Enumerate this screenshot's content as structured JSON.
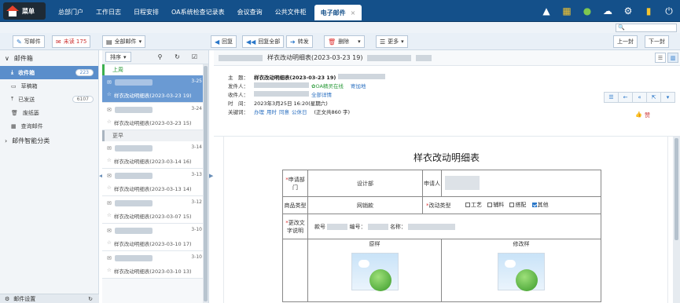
{
  "topbar": {
    "menu_label": "菜单",
    "tabs": [
      {
        "label": "总部门户"
      },
      {
        "label": "工作日志"
      },
      {
        "label": "日程安排"
      },
      {
        "label": "OA系统检查记录表"
      },
      {
        "label": "会议查询"
      },
      {
        "label": "公共文件柜"
      }
    ],
    "active_tab": {
      "label": "电子邮件",
      "close": "×"
    },
    "icons": [
      "notification-icon",
      "apps-icon",
      "user-icon",
      "cloud-icon",
      "gear-icon",
      "clipboard-icon",
      "power-icon"
    ]
  },
  "search": {
    "placeholder": "",
    "icon": "🔍"
  },
  "toolbar": {
    "write": "写邮件",
    "unread": "未读 175",
    "all_mail": "全部邮件",
    "reply": "回复",
    "reply_all": "回复全部",
    "forward": "转发",
    "delete": "删除",
    "more": "更多",
    "prev": "上一封",
    "next": "下一封"
  },
  "sidebar": {
    "mailbox_title": "邮件箱",
    "items": [
      {
        "label": "收件箱",
        "count": "223"
      },
      {
        "label": "草稿箱",
        "count": ""
      },
      {
        "label": "已发送",
        "count": "6107"
      },
      {
        "label": "废纸篓",
        "count": ""
      },
      {
        "label": "查询邮件",
        "count": ""
      }
    ],
    "smart_title": "邮件智能分类",
    "footer": "邮件设置"
  },
  "maillist": {
    "sort_label": "排序",
    "group_recent": "上周",
    "group_earlier": "更早",
    "mails": [
      {
        "date": "3-25",
        "subject": "样衣改动明细表(2023-03-23 19)"
      },
      {
        "date": "3-24",
        "subject": "样衣改动明细表(2023-03-23 15)"
      },
      {
        "date": "3-14",
        "subject": "样衣改动明细表(2023-03-14 16)"
      },
      {
        "date": "3-13",
        "subject": "样衣改动明细表(2023-03-13 14)"
      },
      {
        "date": "3-12",
        "subject": "样衣改动明细表(2023-03-07 15)"
      },
      {
        "date": "3-10",
        "subject": "样衣改动明细表(2023-03-10 17)"
      },
      {
        "date": "3-10",
        "subject": "样衣改动明细表(2023-03-10 13)"
      }
    ]
  },
  "reader": {
    "title": "样衣改动明细表(2023-03-23 19)",
    "subject_label": "主　题：",
    "subject_value": "样衣改动明细表(2023-03-23 19)",
    "sender_label": "发件人：",
    "sender_status": "OA精灵在线",
    "sender_link": "寄加地",
    "receiver_label": "收件人：",
    "receiver_link": "全部详情",
    "time_label": "时　间：",
    "time_value": "2023年3月25日 16:20(星期六)",
    "keywords_label": "关键词：",
    "keywords": [
      "办理",
      "用时",
      "同意",
      "公休日"
    ],
    "word_count": "(正文共860 字)",
    "like": "赞"
  },
  "document": {
    "title": "样衣改动明细表",
    "apply_dept_label": "申请部门",
    "dept_value": "设计部",
    "applicant_label": "申请人",
    "product_type_label": "商品类型",
    "product_type_value": "网销款",
    "change_type_label": "改动类型",
    "change_options": [
      {
        "label": "工艺",
        "checked": false
      },
      {
        "label": "辅料",
        "checked": false
      },
      {
        "label": "搭配",
        "checked": false
      },
      {
        "label": "其他",
        "checked": true
      }
    ],
    "change_desc_label": "更改文字说明",
    "style_no_label": "款号",
    "code_label": "编号：",
    "name_label": "名称：",
    "original_label": "原样",
    "modified_label": "修改样"
  },
  "colors": {
    "topbar": "#14508a",
    "selected": "#6a9ad3",
    "accent": "#2a77c9",
    "required": "#d33333"
  }
}
